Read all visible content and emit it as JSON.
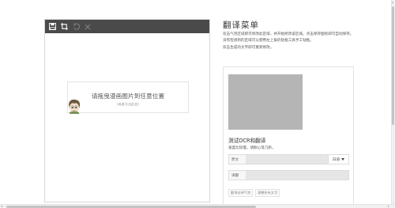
{
  "editor": {
    "toolbar": {
      "icons": [
        "save-icon",
        "crop-icon",
        "undo-icon",
        "close-icon"
      ]
    },
    "dropzone": {
      "main_text": "请拖曳漫画图片到任意位置",
      "sub_text": "（或者点击此处）"
    }
  },
  "panel": {
    "title": "翻译菜单",
    "description": [
      "双击气泡区域即可修改此区域，并开始修改该区域。点击保存图标即可自动保存。",
      "没有检测到的区域可以使用左上角的钻框工具手工钻框。",
      "双击生成的文字即可重新修改。"
    ],
    "ocr_title": "测试OCR和翻译",
    "ocr_subtitle": "速度比较慢，请耐心等几秒。",
    "original_label": "原文",
    "original_value": "",
    "language_select": "日语",
    "translation_label": "译翻",
    "translation_value": "",
    "buttons": [
      "翻译去掉气泡",
      "填整所有文字"
    ]
  },
  "colors": {
    "toolbar": "#4a4a4a",
    "preview": "#b5b5b5",
    "field": "#e6e6e6"
  }
}
